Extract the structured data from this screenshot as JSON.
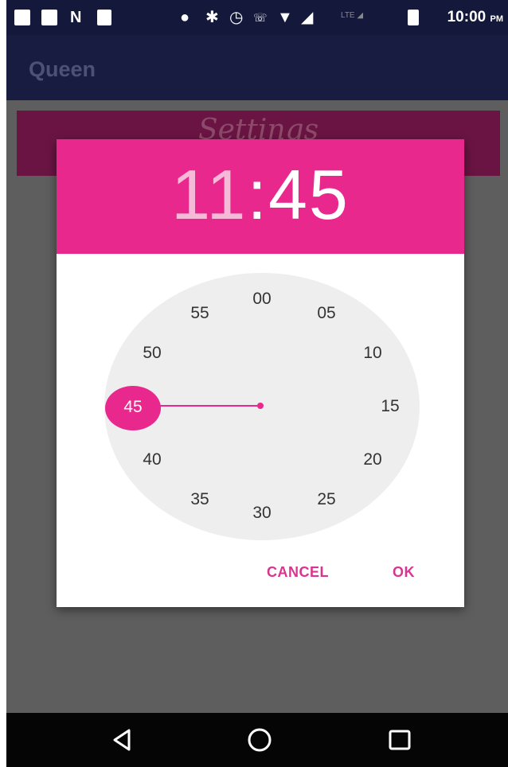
{
  "status_bar": {
    "time": "10:00",
    "ampm": "PM",
    "icons": [
      "image-icon",
      "square-icon",
      "n-icon",
      "phone-icon",
      "location-icon",
      "bluetooth-icon",
      "alarm-icon",
      "call-4g-icon",
      "wifi-icon",
      "signal-icon",
      "lte-signal-icon",
      "battery-icon"
    ]
  },
  "app_bar": {
    "title": "Queen"
  },
  "settings_banner": {
    "text": "Settings"
  },
  "time_picker": {
    "hour": "11",
    "separator": ":",
    "minute": "45",
    "selected_minute": "45",
    "minute_labels": [
      "00",
      "05",
      "10",
      "15",
      "20",
      "25",
      "30",
      "35",
      "40",
      "50",
      "55"
    ],
    "accent_color": "#e9288e"
  },
  "buttons": {
    "cancel": "CANCEL",
    "ok": "OK"
  },
  "nav_bar": {
    "icons": [
      "back-icon",
      "home-icon",
      "recents-icon"
    ]
  }
}
